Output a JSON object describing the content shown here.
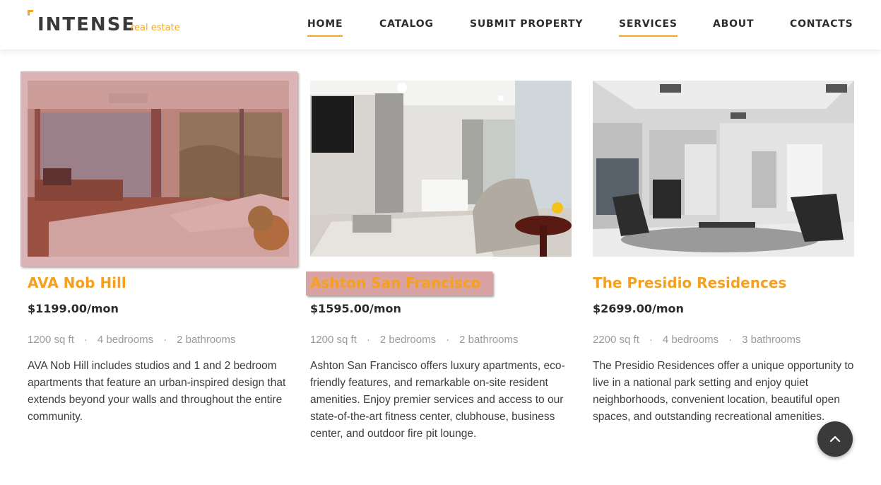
{
  "brand": {
    "name": "INTENSE",
    "tagline": "real estate",
    "accent_color": "#f5a623"
  },
  "nav": {
    "items": [
      {
        "label": "HOME",
        "active": true
      },
      {
        "label": "CATALOG",
        "active": false
      },
      {
        "label": "SUBMIT PROPERTY",
        "active": false
      },
      {
        "label": "SERVICES",
        "active": true
      },
      {
        "label": "ABOUT",
        "active": false
      },
      {
        "label": "CONTACTS",
        "active": false
      }
    ]
  },
  "listings": [
    {
      "title": "AVA Nob Hill",
      "price": "$1199.00/mon",
      "area": "1200 sq ft",
      "bedrooms": "4 bedrooms",
      "bathrooms": "2 bathrooms",
      "separator": "·",
      "description": "AVA Nob Hill includes studios and 1 and 2 bedroom apartments that feature an urban-inspired design that extends beyond your walls and throughout the entire community.",
      "image_icon": "bedroom-photo"
    },
    {
      "title": "Ashton San Francisco",
      "price": "$1595.00/mon",
      "area": "1200 sq ft",
      "bedrooms": "2 bedrooms",
      "bathrooms": "2 bathrooms",
      "separator": "·",
      "description": "Ashton San Francisco offers luxury apartments, eco-friendly features, and remarkable on-site resident amenities. Enjoy premier services and access to our state-of-the-art fitness center, clubhouse, business center, and outdoor fire pit lounge.",
      "image_icon": "living-room-photo"
    },
    {
      "title": "The Presidio Residences",
      "price": "$2699.00/mon",
      "area": "2200 sq ft",
      "bedrooms": "4 bedrooms",
      "bathrooms": "3 bathrooms",
      "separator": "·",
      "description": "The Presidio Residences offer a unique opportunity to live in a national park setting and enjoy quiet neighborhoods, convenient location, beautiful open spaces, and outstanding recreational amenities.",
      "image_icon": "lounge-photo"
    }
  ],
  "back_to_top": {
    "icon": "chevron-up-icon"
  }
}
